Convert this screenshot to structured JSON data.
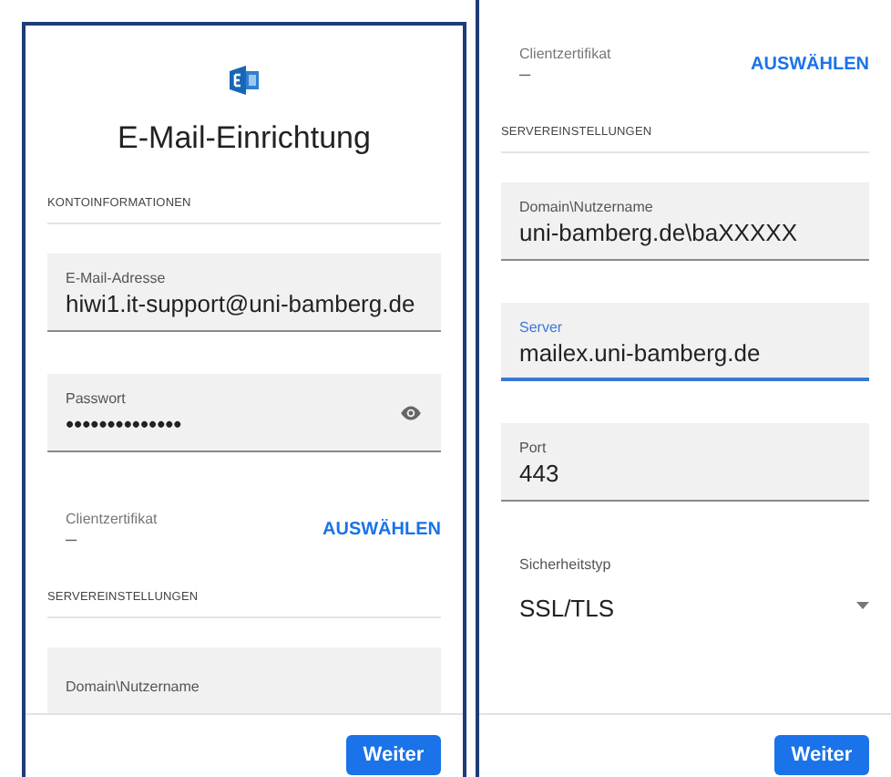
{
  "screens": [
    {
      "items": [
        {
          "kind": "logo"
        },
        {
          "kind": "title",
          "text": "E-Mail-Einrichtung"
        },
        {
          "kind": "section",
          "text": "KONTOINFORMATIONEN"
        },
        {
          "kind": "field",
          "label": "E-Mail-Adresse",
          "value": "hiwi1.it-support@uni-bamberg.de",
          "focused": false
        },
        {
          "kind": "password",
          "label": "Passwort",
          "value": "••••••••••••••",
          "focused": false
        },
        {
          "kind": "cert",
          "label": "Clientzertifikat",
          "value": "–",
          "action": "AUSWÄHLEN"
        },
        {
          "kind": "section",
          "text": "SERVEREINSTELLUNGEN"
        },
        {
          "kind": "field",
          "label": "Domain\\Nutzername",
          "focused": false
        }
      ],
      "button": "Weiter"
    },
    {
      "items": [
        {
          "kind": "cert",
          "label": "Clientzertifikat",
          "value": "–",
          "action": "AUSWÄHLEN"
        },
        {
          "kind": "section",
          "text": "SERVEREINSTELLUNGEN"
        },
        {
          "kind": "field",
          "label": "Domain\\Nutzername",
          "value": "uni-bamberg.de\\baXXXXX",
          "focused": false
        },
        {
          "kind": "field",
          "label": "Server",
          "value": "mailex.uni-bamberg.de",
          "focused": true
        },
        {
          "kind": "field",
          "label": "Port",
          "value": "443",
          "focused": false
        },
        {
          "kind": "select",
          "label": "Sicherheitstyp",
          "value": "SSL/TLS"
        }
      ],
      "button": "Weiter"
    }
  ]
}
